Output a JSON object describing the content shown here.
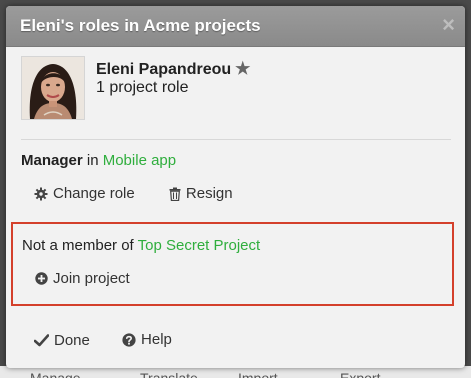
{
  "background": {
    "menu_items": [
      "Manage",
      "Translate",
      "Import",
      "Export"
    ]
  },
  "dialog": {
    "title": "Eleni's roles in Acme projects",
    "close_symbol": "×"
  },
  "user": {
    "name": "Eleni Papandreou",
    "roles_count": "1 project role"
  },
  "role": {
    "name": "Manager",
    "in_text": "in",
    "project": "Mobile app",
    "change_role_label": "Change role",
    "resign_label": "Resign"
  },
  "non_member": {
    "text": "Not a member of",
    "project": "Top Secret Project",
    "join_label": "Join project"
  },
  "footer": {
    "done_label": "Done",
    "help_label": "Help"
  },
  "colors": {
    "link_green": "#2fae3d",
    "highlight_red": "#d4402b",
    "title_bar": "#8f8f8f"
  }
}
